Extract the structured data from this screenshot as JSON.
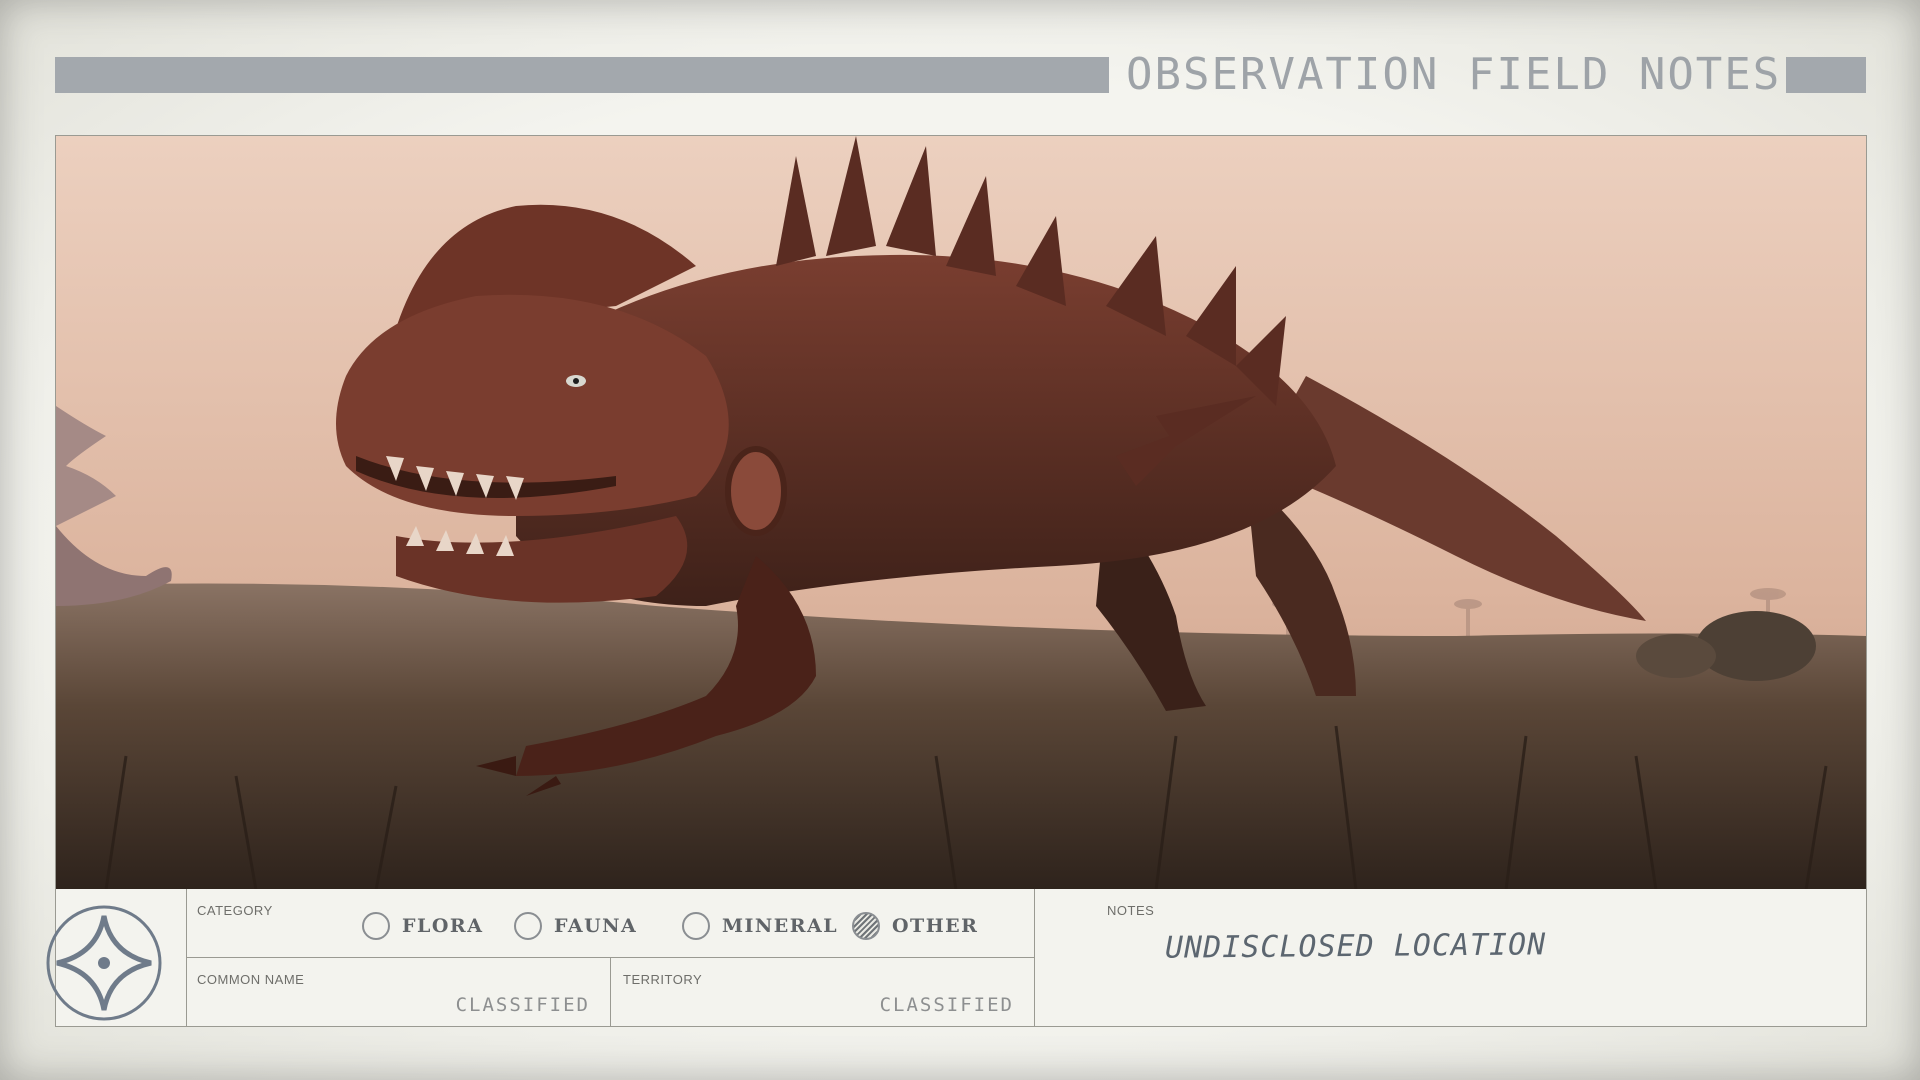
{
  "header": {
    "title": "OBSERVATION FIELD NOTES"
  },
  "photo": {
    "subject": "dinosaur-creature-image"
  },
  "form": {
    "category": {
      "label": "CATEGORY",
      "options": [
        {
          "label": "FLORA",
          "selected": false
        },
        {
          "label": "FAUNA",
          "selected": false
        },
        {
          "label": "MINERAL",
          "selected": false
        },
        {
          "label": "OTHER",
          "selected": true
        }
      ]
    },
    "common_name": {
      "label": "COMMON NAME",
      "value": "CLASSIFIED"
    },
    "territory": {
      "label": "TERRITORY",
      "value": "CLASSIFIED"
    },
    "notes": {
      "label": "NOTES",
      "value": "UNDISCLOSED LOCATION"
    }
  },
  "colors": {
    "accent_bar": "#a3a8ad",
    "card_background": "#f3f3ee",
    "sky": "#e9cdbb",
    "creature": "#6a3528"
  },
  "icons": {
    "logo": "four-point-star-emblem-icon"
  }
}
